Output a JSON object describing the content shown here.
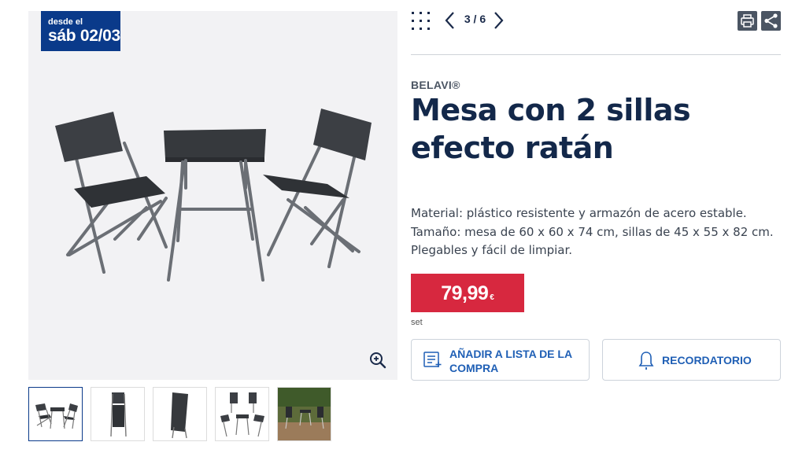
{
  "badge": {
    "line1": "desde el",
    "line2": "sáb 02/03"
  },
  "pager": {
    "text": "3 / 6"
  },
  "product": {
    "brand": "BELAVI®",
    "title": "Mesa con 2 sillas efecto ratán",
    "description": [
      "Material: plástico resistente y armazón de acero estable.",
      "Tamaño: mesa de 60 x 60 x 74 cm, sillas de 45 x 55 x 82 cm.",
      "Plegables y fácil de limpiar."
    ],
    "price": "79,99",
    "currency": "€",
    "unit": "set"
  },
  "actions": {
    "add_to_list": "AÑADIR A LISTA DE LA COMPRA",
    "reminder": "RECORDATORIO"
  },
  "icons": {
    "grid": "grid-icon",
    "prev": "chevron-left-icon",
    "next": "chevron-right-icon",
    "print": "printer-icon",
    "share": "share-icon",
    "zoom": "zoom-in-icon",
    "list": "shopping-list-icon",
    "bell": "bell-icon"
  },
  "colors": {
    "badge": "#0a3a8a",
    "price": "#d7283f",
    "accent": "#1f5fb5",
    "title": "#13284a"
  }
}
